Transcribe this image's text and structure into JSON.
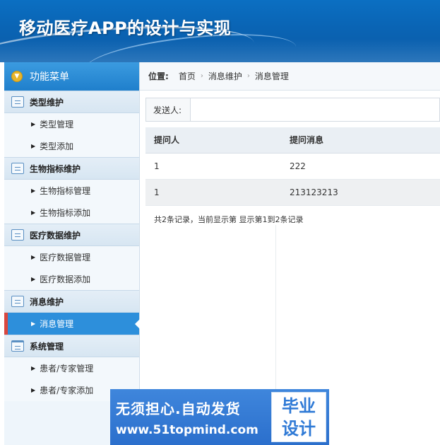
{
  "header": {
    "title": "移动医疗APP的设计与实现"
  },
  "sidebar": {
    "menu_title": "功能菜单",
    "sections": [
      {
        "label": "类型维护",
        "items": [
          "类型管理",
          "类型添加"
        ]
      },
      {
        "label": "生物指标维护",
        "items": [
          "生物指标管理",
          "生物指标添加"
        ]
      },
      {
        "label": "医疗数据维护",
        "items": [
          "医疗数据管理",
          "医疗数据添加"
        ]
      },
      {
        "label": "消息维护",
        "items": [
          "消息管理"
        ]
      },
      {
        "label": "系统管理",
        "items": [
          "患者/专家管理",
          "患者/专家添加"
        ]
      }
    ],
    "active_item": "消息管理"
  },
  "breadcrumb": {
    "label": "位置:",
    "crumbs": [
      "首页",
      "消息维护",
      "消息管理"
    ]
  },
  "filter": {
    "label": "发送人:",
    "value": "",
    "placeholder": ""
  },
  "table": {
    "headers": [
      "提问人",
      "提问消息"
    ],
    "rows": [
      [
        "1",
        "222"
      ],
      [
        "1",
        "213123213"
      ]
    ]
  },
  "pager": {
    "text": "共2条记录，当前显示第  显示第1到2条记录"
  },
  "ad": {
    "line1": "无须担心.自动发货",
    "line2": "www.51topmind.com",
    "box_line1": "毕业",
    "box_line2": "设计"
  },
  "colors": {
    "header_blue": "#0a64b4",
    "active_item": "#2d8fdb",
    "active_marker": "#d9473f"
  }
}
